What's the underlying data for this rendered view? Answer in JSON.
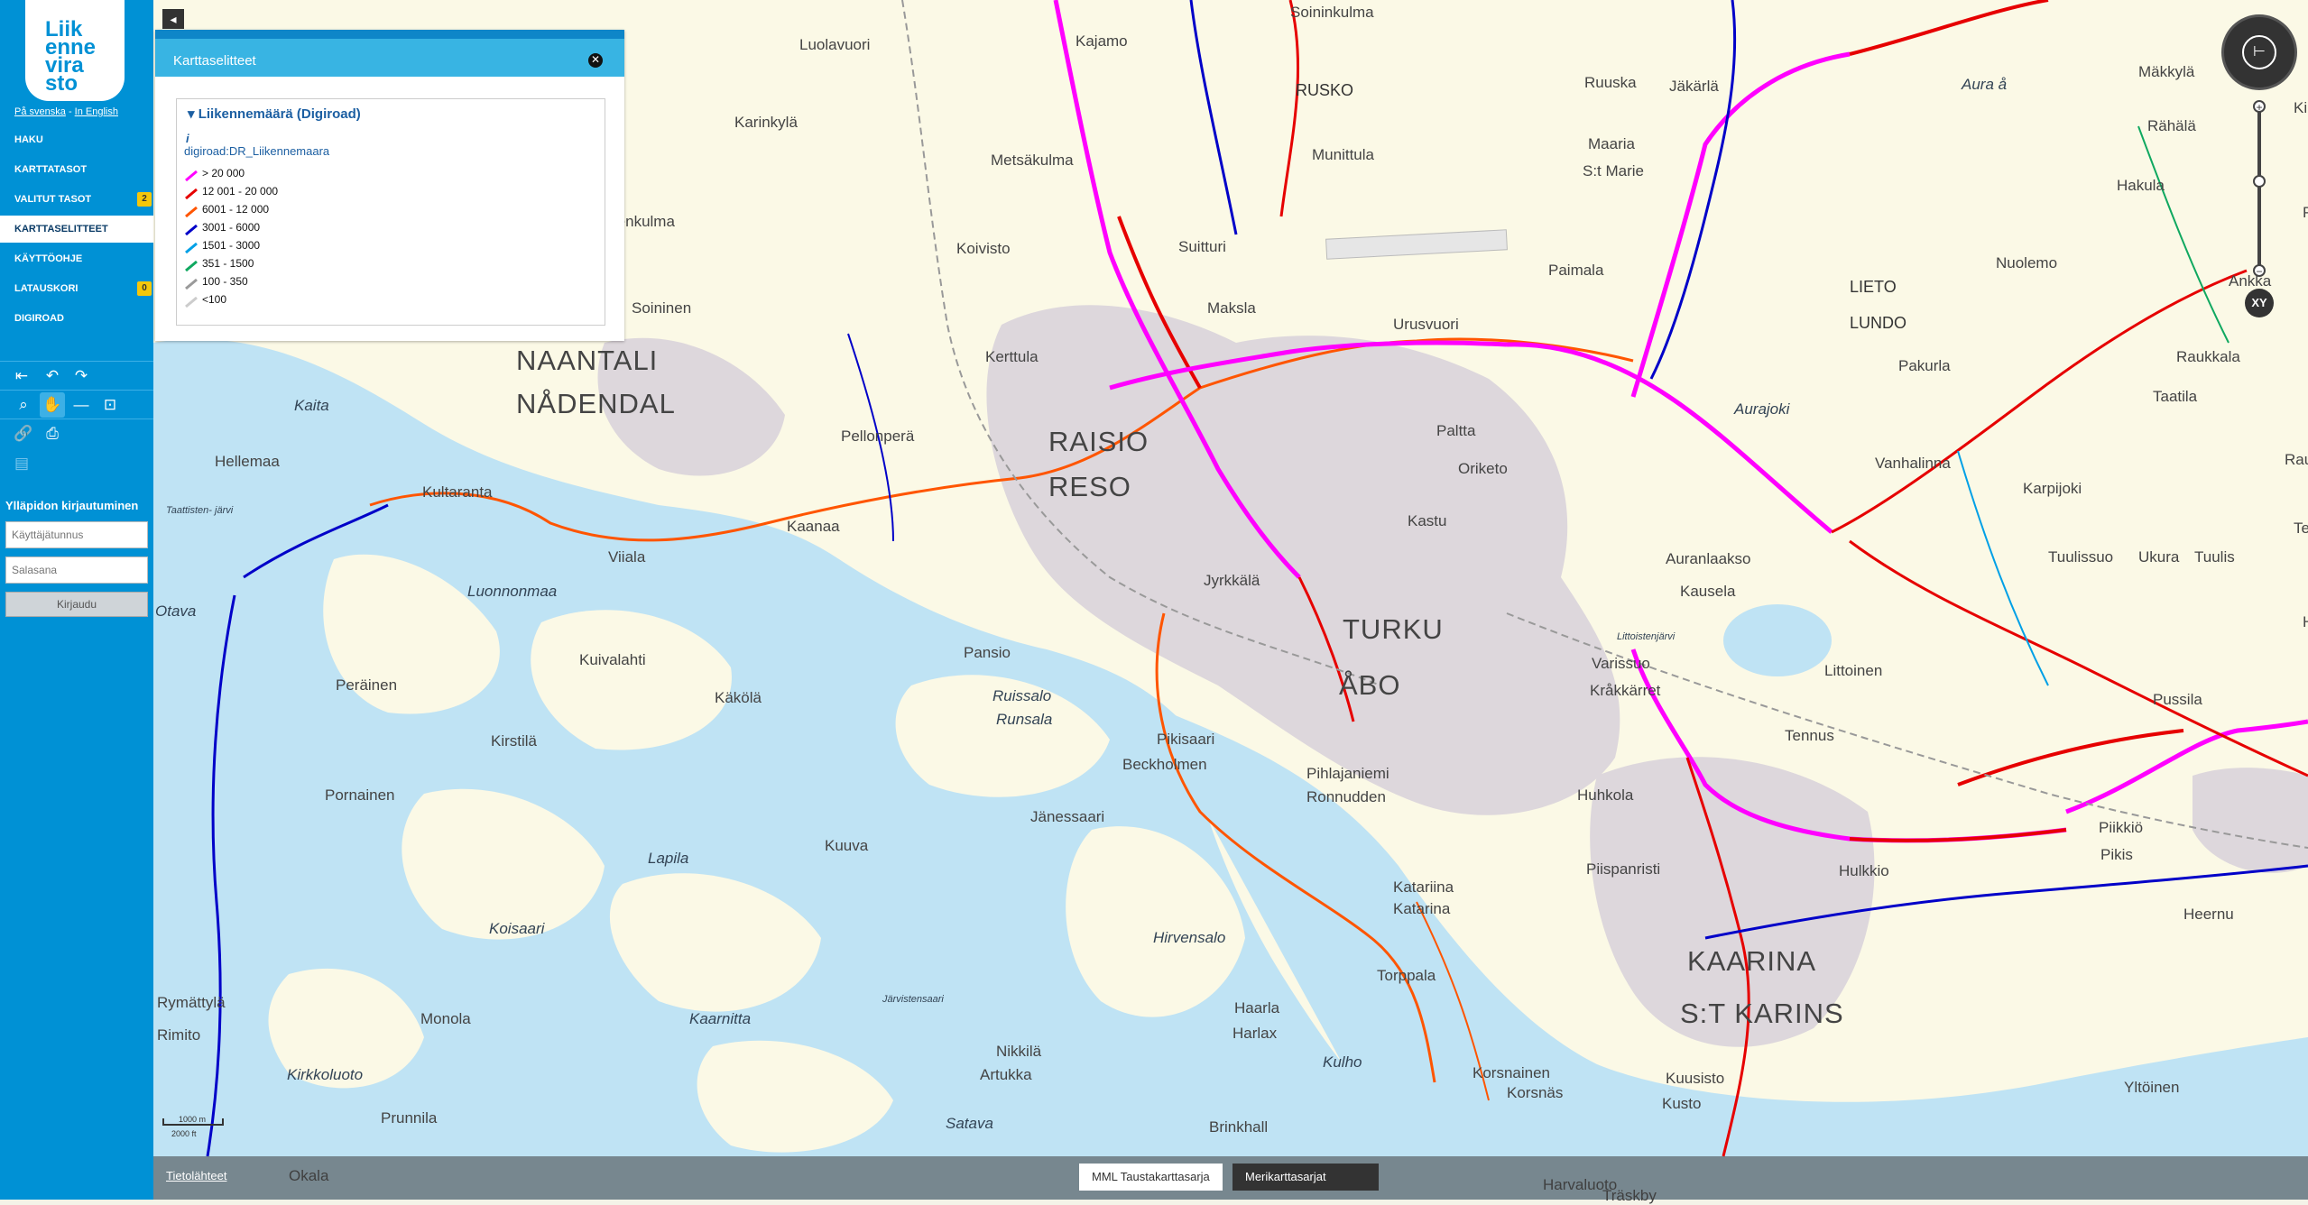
{
  "sidebar": {
    "logo_lines": [
      "Liik",
      "enne",
      "vira",
      "sto"
    ],
    "lang_sv": "På svenska",
    "lang_sep": "-",
    "lang_en": "In English",
    "menu": [
      {
        "label": "HAKU"
      },
      {
        "label": "KARTTATASOT"
      },
      {
        "label": "VALITUT TASOT",
        "badge": "2"
      },
      {
        "label": "KARTTASELITTEET",
        "active": true
      },
      {
        "label": "KÄYTTÖOHJE"
      },
      {
        "label": "LATAUSKORI",
        "badge": "0"
      },
      {
        "label": "DIGIROAD"
      }
    ],
    "login": {
      "title": "Ylläpidon kirjautuminen",
      "username_placeholder": "Käyttäjätunnus",
      "password_placeholder": "Salasana",
      "button": "Kirjaudu"
    }
  },
  "panel": {
    "title": "Karttaselitteet",
    "legend_title": "Liikennemäärä (Digiroad)",
    "info_icon": "i",
    "layer_name": "digiroad:DR_Liikennemaara",
    "classes": [
      {
        "label": "> 20 000",
        "color": "#ff00ff"
      },
      {
        "label": "12 001 - 20 000",
        "color": "#e60000"
      },
      {
        "label": "6001 - 12 000",
        "color": "#ff5500"
      },
      {
        "label": "3001 - 6000",
        "color": "#0000c8"
      },
      {
        "label": "1501 - 3000",
        "color": "#00a0e6"
      },
      {
        "label": "351 - 1500",
        "color": "#10a860"
      },
      {
        "label": "100 - 350",
        "color": "#9a9a9a"
      },
      {
        "label": "<100",
        "color": "#cccccc"
      }
    ]
  },
  "map": {
    "places": [
      {
        "name": "NAANTALI",
        "cls": "city"
      },
      {
        "name": "NÅDENDAL",
        "cls": "city"
      },
      {
        "name": "RAISIO",
        "cls": "city"
      },
      {
        "name": "RESO",
        "cls": "city"
      },
      {
        "name": "TURKU",
        "cls": "city"
      },
      {
        "name": "ÅBO",
        "cls": "city"
      },
      {
        "name": "KAARINA",
        "cls": "city"
      },
      {
        "name": "S:T KARINS",
        "cls": "city"
      },
      {
        "name": "RUSKO",
        "cls": "town"
      },
      {
        "name": "LIETO",
        "cls": "town"
      },
      {
        "name": "LUNDO",
        "cls": "town"
      },
      {
        "name": "Luolavuori",
        "cls": "vil"
      },
      {
        "name": "Karinkylä",
        "cls": "vil"
      },
      {
        "name": "Kajamo",
        "cls": "vil"
      },
      {
        "name": "Metsäkulma",
        "cls": "vil"
      },
      {
        "name": "Munittula",
        "cls": "vil"
      },
      {
        "name": "Ruuska",
        "cls": "vil"
      },
      {
        "name": "Jäkärlä",
        "cls": "vil"
      },
      {
        "name": "Maaria",
        "cls": "vil"
      },
      {
        "name": "S:t Marie",
        "cls": "vil"
      },
      {
        "name": "Mäkkylä",
        "cls": "vil"
      },
      {
        "name": "Rähälä",
        "cls": "vil"
      },
      {
        "name": "Hakula",
        "cls": "vil"
      },
      {
        "name": "Niemenkulma",
        "cls": "vil"
      },
      {
        "name": "Koivisto",
        "cls": "vil"
      },
      {
        "name": "Suitturi",
        "cls": "vil"
      },
      {
        "name": "Paimala",
        "cls": "vil"
      },
      {
        "name": "Nuolemo",
        "cls": "vil"
      },
      {
        "name": "Ankka",
        "cls": "vil"
      },
      {
        "name": "Soininen",
        "cls": "vil"
      },
      {
        "name": "Maksla",
        "cls": "vil"
      },
      {
        "name": "Urusvuori",
        "cls": "vil"
      },
      {
        "name": "Kerttula",
        "cls": "vil"
      },
      {
        "name": "Pakurla",
        "cls": "vil"
      },
      {
        "name": "Raukkala",
        "cls": "vil"
      },
      {
        "name": "Paltta",
        "cls": "vil"
      },
      {
        "name": "Taatila",
        "cls": "vil"
      },
      {
        "name": "Pellonperä",
        "cls": "vil"
      },
      {
        "name": "Oriketo",
        "cls": "vil"
      },
      {
        "name": "Vanhalinna",
        "cls": "vil"
      },
      {
        "name": "Hellemaa",
        "cls": "vil"
      },
      {
        "name": "Kultaranta",
        "cls": "vil"
      },
      {
        "name": "Kaanaa",
        "cls": "vil"
      },
      {
        "name": "Kastu",
        "cls": "vil"
      },
      {
        "name": "Karpijoki",
        "cls": "vil"
      },
      {
        "name": "Viiala",
        "cls": "vil"
      },
      {
        "name": "Auranlaakso",
        "cls": "vil"
      },
      {
        "name": "Tuulissuo",
        "cls": "vil"
      },
      {
        "name": "Ukura",
        "cls": "vil"
      },
      {
        "name": "Jyrkkälä",
        "cls": "vil"
      },
      {
        "name": "Kausela",
        "cls": "vil"
      },
      {
        "name": "Pansio",
        "cls": "vil"
      },
      {
        "name": "Kuivalahti",
        "cls": "vil"
      },
      {
        "name": "Varissuo",
        "cls": "vil"
      },
      {
        "name": "Kråkkärret",
        "cls": "vil"
      },
      {
        "name": "Littoinen",
        "cls": "vil"
      },
      {
        "name": "Peräinen",
        "cls": "vil"
      },
      {
        "name": "Käkölä",
        "cls": "vil"
      },
      {
        "name": "Pussila",
        "cls": "vil"
      },
      {
        "name": "Kirstilä",
        "cls": "vil"
      },
      {
        "name": "Pikisaari",
        "cls": "vil"
      },
      {
        "name": "Beckholmen",
        "cls": "vil"
      },
      {
        "name": "Tennus",
        "cls": "vil"
      },
      {
        "name": "Pornainen",
        "cls": "vil"
      },
      {
        "name": "Pihlajaniemi",
        "cls": "vil"
      },
      {
        "name": "Ronnudden",
        "cls": "vil"
      },
      {
        "name": "Huhkola",
        "cls": "vil"
      },
      {
        "name": "Jänessaari",
        "cls": "vil"
      },
      {
        "name": "Piikkiö",
        "cls": "vil"
      },
      {
        "name": "Pikis",
        "cls": "vil"
      },
      {
        "name": "Kuuva",
        "cls": "vil"
      },
      {
        "name": "Piispanristi",
        "cls": "vil"
      },
      {
        "name": "Hulkkio",
        "cls": "vil"
      },
      {
        "name": "Katariina",
        "cls": "vil"
      },
      {
        "name": "Katarina",
        "cls": "vil"
      },
      {
        "name": "Heernu",
        "cls": "vil"
      },
      {
        "name": "Rymättylä",
        "cls": "vil"
      },
      {
        "name": "Rimito",
        "cls": "vil"
      },
      {
        "name": "Monola",
        "cls": "vil"
      },
      {
        "name": "Haarla",
        "cls": "vil"
      },
      {
        "name": "Harlax",
        "cls": "vil"
      },
      {
        "name": "Torppala",
        "cls": "vil"
      },
      {
        "name": "Nikkilä",
        "cls": "vil"
      },
      {
        "name": "Artukka",
        "cls": "vil"
      },
      {
        "name": "Korsnainen",
        "cls": "vil"
      },
      {
        "name": "Korsnäs",
        "cls": "vil"
      },
      {
        "name": "Yltöinen",
        "cls": "vil"
      },
      {
        "name": "Prunnila",
        "cls": "vil"
      },
      {
        "name": "Brinkhall",
        "cls": "vil"
      },
      {
        "name": "Okala",
        "cls": "vil"
      },
      {
        "name": "Harvaluoto",
        "cls": "vil"
      },
      {
        "name": "Kusto",
        "cls": "vil"
      },
      {
        "name": "Kuusisto",
        "cls": "vil"
      },
      {
        "name": "Träskby",
        "cls": "vil"
      },
      {
        "name": "Soininkulma",
        "cls": "vil"
      },
      {
        "name": "Kaita",
        "cls": "water"
      },
      {
        "name": "Otava",
        "cls": "water"
      },
      {
        "name": "Luonnonmaa",
        "cls": "water"
      },
      {
        "name": "Ruissalo",
        "cls": "water"
      },
      {
        "name": "Runsala",
        "cls": "water"
      },
      {
        "name": "Lapila",
        "cls": "water"
      },
      {
        "name": "Koisaari",
        "cls": "water"
      },
      {
        "name": "Hirvensalo",
        "cls": "water"
      },
      {
        "name": "Järvistensaari",
        "cls": "water"
      },
      {
        "name": "Kaarnitta",
        "cls": "water"
      },
      {
        "name": "Kulho",
        "cls": "water"
      },
      {
        "name": "Satava",
        "cls": "water"
      },
      {
        "name": "Kirkkoluoto",
        "cls": "water"
      },
      {
        "name": "Taattisten- järvi",
        "cls": "water"
      },
      {
        "name": "Littoistenjärvi",
        "cls": "water"
      },
      {
        "name": "Aurajoki",
        "cls": "water"
      },
      {
        "name": "Aura å",
        "cls": "water"
      },
      {
        "name": "Tuulis",
        "cls": "vil"
      },
      {
        "name": "Rautsuo",
        "cls": "vil"
      },
      {
        "name": "Teerla",
        "cls": "vil"
      },
      {
        "name": "Hepoj",
        "cls": "vil"
      },
      {
        "name": "Pränil",
        "cls": "vil"
      },
      {
        "name": "Kir",
        "cls": "vil"
      }
    ],
    "scale_m": "1000 m",
    "scale_ft": "2000 ft",
    "compass_icon": "⊢",
    "xy_label": "XY"
  },
  "bottom": {
    "sources": "Tietolähteet",
    "bg_buttons": [
      "MML Taustakarttasarja",
      "Merikarttasarjat"
    ],
    "active_bg": "Merikarttasarjat"
  }
}
